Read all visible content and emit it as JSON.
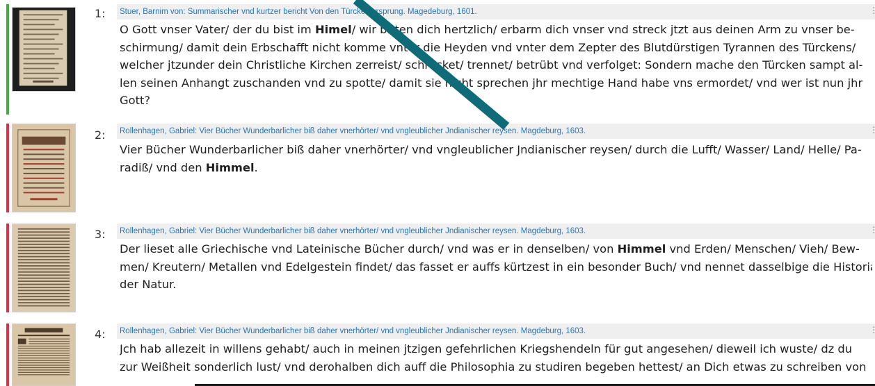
{
  "results": [
    {
      "number": "1:",
      "source": "Stuer, Barnim von: Summarischer vnd kurtzer bericht Von den Türcken vrsprung. Magedeburg, 1601.",
      "bar_color": "#3fae3f",
      "thumb_style": "plain",
      "lines": [
        [
          "O Gott vnser Vater/ der du bist im ",
          "Himel",
          "/ wir bitten dich hertzlich/ erbarm dich vnser vnd streck jtzt aus deinen Arm zu vnser be-"
        ],
        [
          "schirmung/ damit dein Erbschafft nicht komme vnter die Heyden vnd vnter dem Zepter des Blutdürstigen Tyrannen des Türckens/"
        ],
        [
          "welcher jtzunder dein Christliche Kirchen zerreist/ schrecket/ trennet/ betrübt vnd verfolget: Sondern mache den Türcken sampt al-"
        ],
        [
          "len seinen Anhangt zuschanden vnd zu spotte/ damit sie nicht sprechen jhr mechtige Hand habe vns ermordet/ vnd wer ist nun jhr"
        ],
        [
          "Gott?"
        ]
      ]
    },
    {
      "number": "2:",
      "source": "Rollenhagen, Gabriel: Vier Bücher Wunderbarlicher biß daher vnerhörter/ vnd vngleublicher Jndianischer reysen. Magdeburg, 1603.",
      "bar_color": "#d9304c",
      "thumb_style": "title",
      "lines": [
        [
          "Vier Bücher Wunderbarlicher biß daher vnerhörter/ vnd vngleublicher Jndianischer reysen/ durch die Lufft/ Wasser/ Land/ Helle/ Pa-"
        ],
        [
          "radiß/ vnd den ",
          "Himmel",
          "."
        ]
      ]
    },
    {
      "number": "3:",
      "source": "Rollenhagen, Gabriel: Vier Bücher Wunderbarlicher biß daher vnerhörter/ vnd vngleublicher Jndianischer reysen. Magdeburg, 1603.",
      "bar_color": "#d9304c",
      "thumb_style": "text",
      "lines": [
        [
          "Der lieset alle Griechische vnd Lateinische Bücher durch/ vnd was er in denselben/ von ",
          "Himmel",
          " vnd Erden/ Menschen/ Vieh/ Bew-"
        ],
        [
          "men/ Kreutern/ Metallen vnd Edelgestein findet/ das fasset er auffs kürtzest in ein besonder Buch/ vnd nennet dasselbige die Historia"
        ],
        [
          "der Natur."
        ]
      ]
    },
    {
      "number": "4:",
      "source": "Rollenhagen, Gabriel: Vier Bücher Wunderbarlicher biß daher vnerhörter/ vnd vngleublicher Jndianischer reysen. Magdeburg, 1603.",
      "bar_color": "#d9304c",
      "thumb_style": "chapter",
      "lines": [
        [
          "Jch hab allezeit in willens gehabt/ auch in meinen jtzigen gefehrlichen Kriegshendeln für gut angesehen/ dieweil ich wuste/ dz du"
        ],
        [
          "zur Weißheit sonderlich lust/ vnd derohalben dich auff die Philosophia zu studiren begeben hettest/ an Dich etwas zu schreiben von"
        ]
      ]
    }
  ],
  "menu_icon": "kebab-menu-icon",
  "annotation_color": "#0f6b78"
}
